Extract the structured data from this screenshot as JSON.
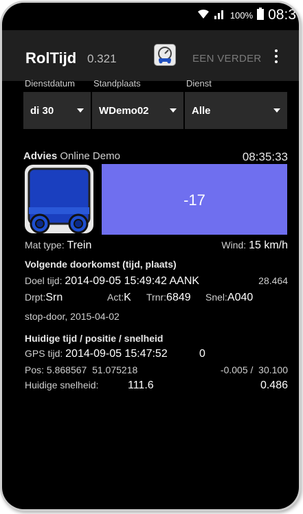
{
  "statusbar": {
    "battery": "100%",
    "time": "08:3"
  },
  "appbar": {
    "title": "RolTijd",
    "version": "0.321",
    "een_verder": "EEN VERDER"
  },
  "selectors": {
    "labels": [
      "Dienstdatum",
      "Standplaats",
      "Dienst"
    ],
    "values": [
      "di 30",
      "WDemo02",
      "Alle"
    ]
  },
  "advies": {
    "label": "Advies",
    "subtitle": "Online Demo",
    "time": "08:35:33",
    "value": "-17",
    "color": "#6f6fef"
  },
  "mat": {
    "label": "Mat type:",
    "value": "Trein"
  },
  "wind": {
    "label": "Wind:",
    "value": "15 km/h"
  },
  "volgende": {
    "heading": "Volgende doorkomst (tijd, plaats)",
    "doel_label": "Doel tijd:",
    "doel_value": "2014-09-05 15:49:42 AANK",
    "doel_extra": "28.464",
    "drpt_label": "Drpt:",
    "drpt_value": "Srn",
    "act_label": "Act:",
    "act_value": "K",
    "trnr_label": "Trnr:",
    "trnr_value": "6849",
    "snel_label": "Snel:",
    "snel_value": "A040",
    "note": "stop-door, 2015-04-02"
  },
  "huidige": {
    "heading": "Huidige tijd / positie / snelheid",
    "gps_label": "GPS tijd:",
    "gps_value": "2014-09-05 15:47:52",
    "gps_extra": "0",
    "pos_label": "Pos:",
    "pos_value": "5.868567  51.075218",
    "pos_extra": "-0.005 /  30.100",
    "snelheid_label": "Huidige snelheid:",
    "snelheid_value": "111.6",
    "snelheid_extra": "0.486"
  }
}
